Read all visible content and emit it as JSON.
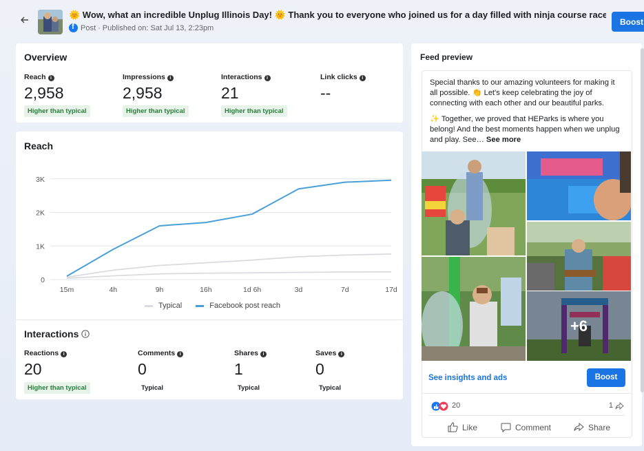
{
  "header": {
    "title": "🌞 Wow, what an incredible Unplug Illinois Day! 🌞 Thank you to everyone who joined us for a day filled with ninja course races, giant b…",
    "subtitle": "Post · Published on: Sat Jul 13, 2:23pm",
    "boost_label": "Boost"
  },
  "overview": {
    "title": "Overview",
    "metrics": [
      {
        "label": "Reach",
        "value": "2,958",
        "badge": "Higher than typical"
      },
      {
        "label": "Impressions",
        "value": "2,958",
        "badge": "Higher than typical"
      },
      {
        "label": "Interactions",
        "value": "21",
        "badge": "Higher than typical"
      },
      {
        "label": "Link clicks",
        "value": "--",
        "badge": ""
      }
    ]
  },
  "reach_section": {
    "title": "Reach",
    "legend": {
      "typical": "Typical",
      "post": "Facebook post reach"
    }
  },
  "interactions": {
    "title": "Interactions",
    "metrics": [
      {
        "label": "Reactions",
        "value": "20",
        "badge": "Higher than typical"
      },
      {
        "label": "Comments",
        "value": "0",
        "badge": "Typical"
      },
      {
        "label": "Shares",
        "value": "1",
        "badge": "Typical"
      },
      {
        "label": "Saves",
        "value": "0",
        "badge": "Typical"
      }
    ]
  },
  "feed": {
    "title": "Feed preview",
    "paragraph1": "Special thanks to our amazing volunteers for making it all possible. 👏 Let's keep celebrating the joy of connecting with each other and our beautiful parks.",
    "paragraph2": "✨ Together, we proved that HEParks is where you belong! And the best moments happen when we unplug and play. See…",
    "see_more": "See more",
    "more_photos": "+6",
    "insights_link": "See insights and ads",
    "boost_label": "Boost",
    "reaction_count": "20",
    "share_count": "1",
    "actions": {
      "like": "Like",
      "comment": "Comment",
      "share": "Share"
    }
  },
  "colors": {
    "accent": "#1b74e4",
    "post_line": "#4a9fd6",
    "typical_line": "#d9dbdf",
    "badge_green": "#287c3c"
  },
  "chart_data": {
    "type": "line",
    "title": "Reach",
    "x": [
      "15m",
      "4h",
      "9h",
      "16h",
      "1d 6h",
      "3d",
      "7d",
      "17d"
    ],
    "y_ticks": [
      "0",
      "1K",
      "2K",
      "3K"
    ],
    "ylim": [
      0,
      3200
    ],
    "grid": true,
    "legend_position": "bottom",
    "series": [
      {
        "name": "Facebook post reach",
        "values": [
          100,
          900,
          1600,
          1700,
          1950,
          2700,
          2900,
          2958
        ]
      },
      {
        "name": "Typical",
        "values": [
          70,
          280,
          420,
          500,
          580,
          680,
          730,
          760
        ]
      },
      {
        "name": "Typical",
        "values": [
          40,
          110,
          170,
          190,
          200,
          215,
          225,
          230
        ]
      }
    ]
  }
}
